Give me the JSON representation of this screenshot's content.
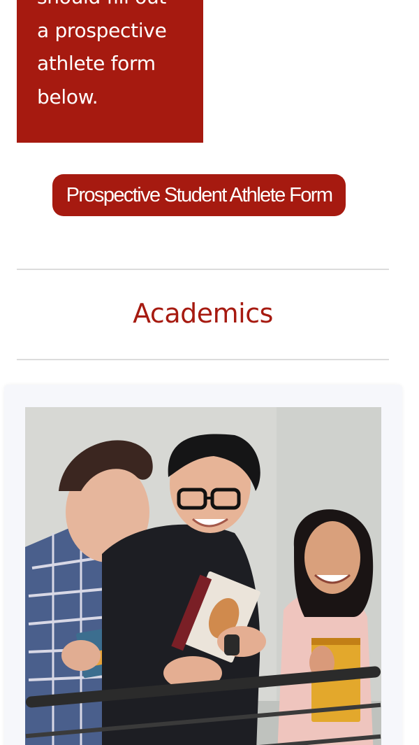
{
  "intro_box": {
    "lines": [
      "should fill out",
      "a prospective",
      "athlete form",
      "below."
    ]
  },
  "cta": {
    "label": "Prospective Student Athlete Form"
  },
  "section": {
    "heading": "Academics"
  },
  "card": {
    "image_alt": "Three students holding books leaning on a railing"
  },
  "colors": {
    "accent": "#a61a10",
    "divider": "#dcdcdc",
    "card_background": "#f6f7fb"
  }
}
